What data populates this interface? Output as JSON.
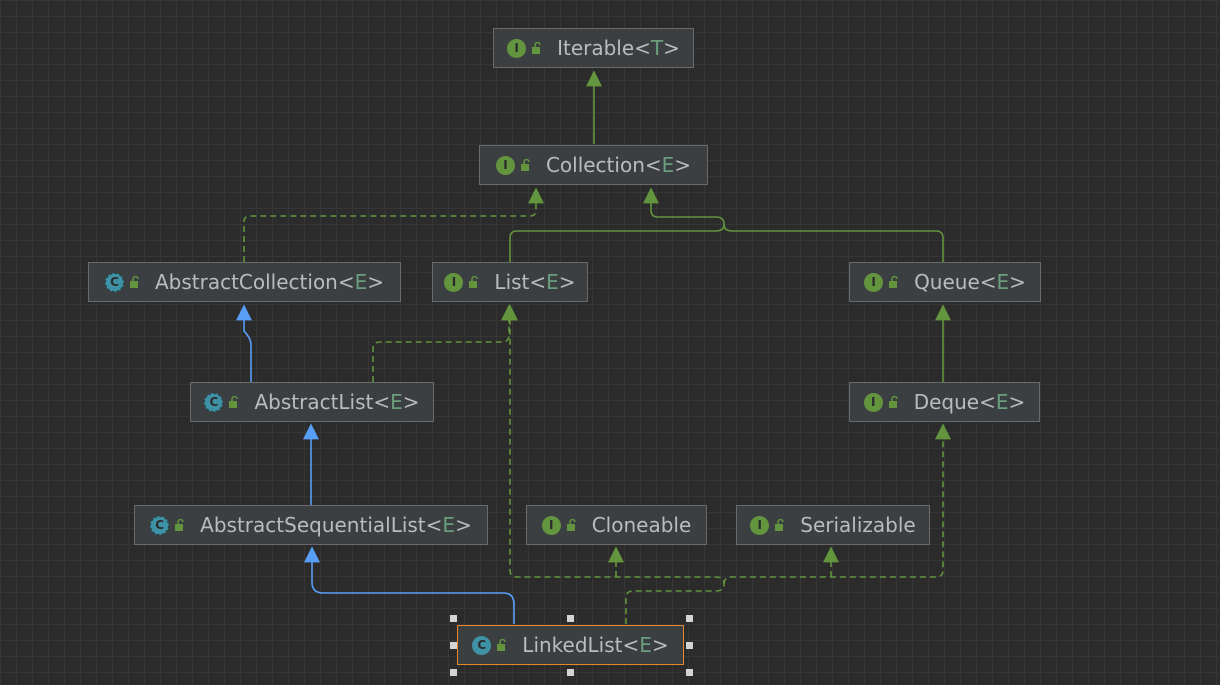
{
  "diagram": {
    "colors": {
      "interface_icon": "#62953e",
      "class_icon": "#3f92a6",
      "extends_edge": "#589df6",
      "implements_edge": "#62953e",
      "selection_border": "#e4892a",
      "type_param": "#6a9e7c"
    },
    "nodes": {
      "iterable": {
        "name": "Iterable",
        "param": "T",
        "kind": "interface",
        "icon": "interface-icon"
      },
      "collection": {
        "name": "Collection",
        "param": "E",
        "kind": "interface",
        "icon": "interface-icon"
      },
      "abstract_collection": {
        "name": "AbstractCollection",
        "param": "E",
        "kind": "abstract-class",
        "icon": "abstract-class-icon"
      },
      "list": {
        "name": "List",
        "param": "E",
        "kind": "interface",
        "icon": "interface-icon"
      },
      "queue": {
        "name": "Queue",
        "param": "E",
        "kind": "interface",
        "icon": "interface-icon"
      },
      "abstract_list": {
        "name": "AbstractList",
        "param": "E",
        "kind": "abstract-class",
        "icon": "abstract-class-icon"
      },
      "deque": {
        "name": "Deque",
        "param": "E",
        "kind": "interface",
        "icon": "interface-icon"
      },
      "abstract_sequential_list": {
        "name": "AbstractSequentialList",
        "param": "E",
        "kind": "abstract-class",
        "icon": "abstract-class-icon"
      },
      "cloneable": {
        "name": "Cloneable",
        "param": "",
        "kind": "interface",
        "icon": "interface-icon"
      },
      "serializable": {
        "name": "Serializable",
        "param": "",
        "kind": "interface",
        "icon": "interface-icon"
      },
      "linked_list": {
        "name": "LinkedList",
        "param": "E",
        "kind": "class",
        "icon": "class-icon",
        "selected": true
      }
    },
    "edges": [
      {
        "from": "Collection",
        "to": "Iterable",
        "type": "extends"
      },
      {
        "from": "AbstractCollection",
        "to": "Collection",
        "type": "implements"
      },
      {
        "from": "List",
        "to": "Collection",
        "type": "extends"
      },
      {
        "from": "Queue",
        "to": "Collection",
        "type": "extends"
      },
      {
        "from": "AbstractList",
        "to": "AbstractCollection",
        "type": "extends"
      },
      {
        "from": "AbstractList",
        "to": "List",
        "type": "implements"
      },
      {
        "from": "Deque",
        "to": "Queue",
        "type": "extends"
      },
      {
        "from": "AbstractSequentialList",
        "to": "AbstractList",
        "type": "extends"
      },
      {
        "from": "LinkedList",
        "to": "AbstractSequentialList",
        "type": "extends"
      },
      {
        "from": "LinkedList",
        "to": "List",
        "type": "implements"
      },
      {
        "from": "LinkedList",
        "to": "Deque",
        "type": "implements"
      },
      {
        "from": "LinkedList",
        "to": "Cloneable",
        "type": "implements"
      },
      {
        "from": "LinkedList",
        "to": "Serializable",
        "type": "implements"
      }
    ]
  }
}
